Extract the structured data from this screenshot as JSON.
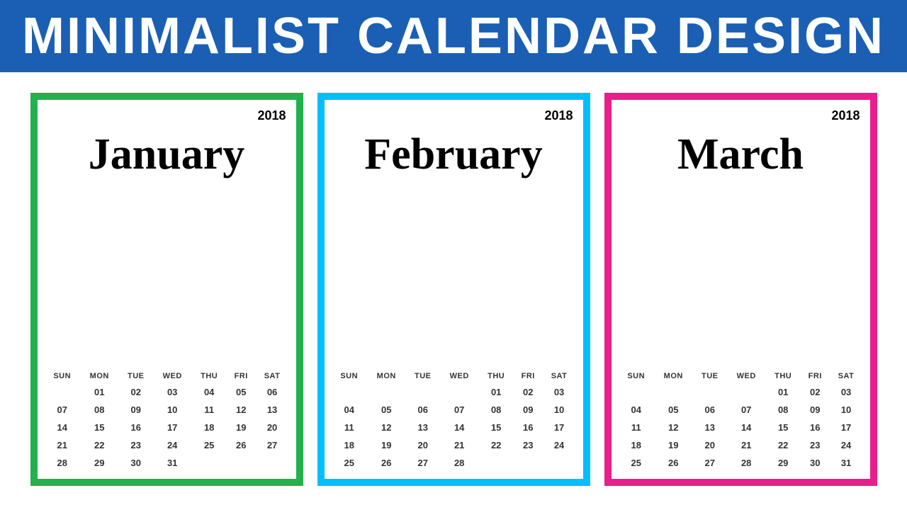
{
  "header": {
    "title": "MINIMALIST CALENDAR DESIGN",
    "bg_color": "#1a5fb4",
    "text_color": "#ffffff"
  },
  "calendars": [
    {
      "id": "january",
      "color": "green",
      "border_color": "#22b14c",
      "year": "2018",
      "month": "January",
      "days_header": [
        "SUN",
        "MON",
        "TUE",
        "WED",
        "THU",
        "FRI",
        "SAT"
      ],
      "weeks": [
        [
          "",
          "01",
          "02",
          "03",
          "04",
          "05",
          "06"
        ],
        [
          "07",
          "08",
          "09",
          "10",
          "11",
          "12",
          "13"
        ],
        [
          "14",
          "15",
          "16",
          "17",
          "18",
          "19",
          "20"
        ],
        [
          "21",
          "22",
          "23",
          "24",
          "25",
          "26",
          "27"
        ],
        [
          "28",
          "29",
          "30",
          "31",
          "",
          "",
          ""
        ]
      ]
    },
    {
      "id": "february",
      "color": "cyan",
      "border_color": "#00bfff",
      "year": "2018",
      "month": "February",
      "days_header": [
        "SUN",
        "MON",
        "TUE",
        "WED",
        "THU",
        "FRI",
        "SAT"
      ],
      "weeks": [
        [
          "",
          "",
          "",
          "",
          "01",
          "02",
          "03"
        ],
        [
          "04",
          "05",
          "06",
          "07",
          "08",
          "09",
          "10"
        ],
        [
          "11",
          "12",
          "13",
          "14",
          "15",
          "16",
          "17"
        ],
        [
          "18",
          "19",
          "20",
          "21",
          "22",
          "23",
          "24"
        ],
        [
          "25",
          "26",
          "27",
          "28",
          "",
          "",
          ""
        ]
      ]
    },
    {
      "id": "march",
      "color": "pink",
      "border_color": "#e91e8c",
      "year": "2018",
      "month": "March",
      "days_header": [
        "SUN",
        "MON",
        "TUE",
        "WED",
        "THU",
        "FRI",
        "SAT"
      ],
      "weeks": [
        [
          "",
          "",
          "",
          "",
          "01",
          "02",
          "03"
        ],
        [
          "04",
          "05",
          "06",
          "07",
          "08",
          "09",
          "10"
        ],
        [
          "11",
          "12",
          "13",
          "14",
          "15",
          "16",
          "17"
        ],
        [
          "18",
          "19",
          "20",
          "21",
          "22",
          "23",
          "24"
        ],
        [
          "25",
          "26",
          "27",
          "28",
          "29",
          "30",
          "31"
        ]
      ]
    }
  ]
}
